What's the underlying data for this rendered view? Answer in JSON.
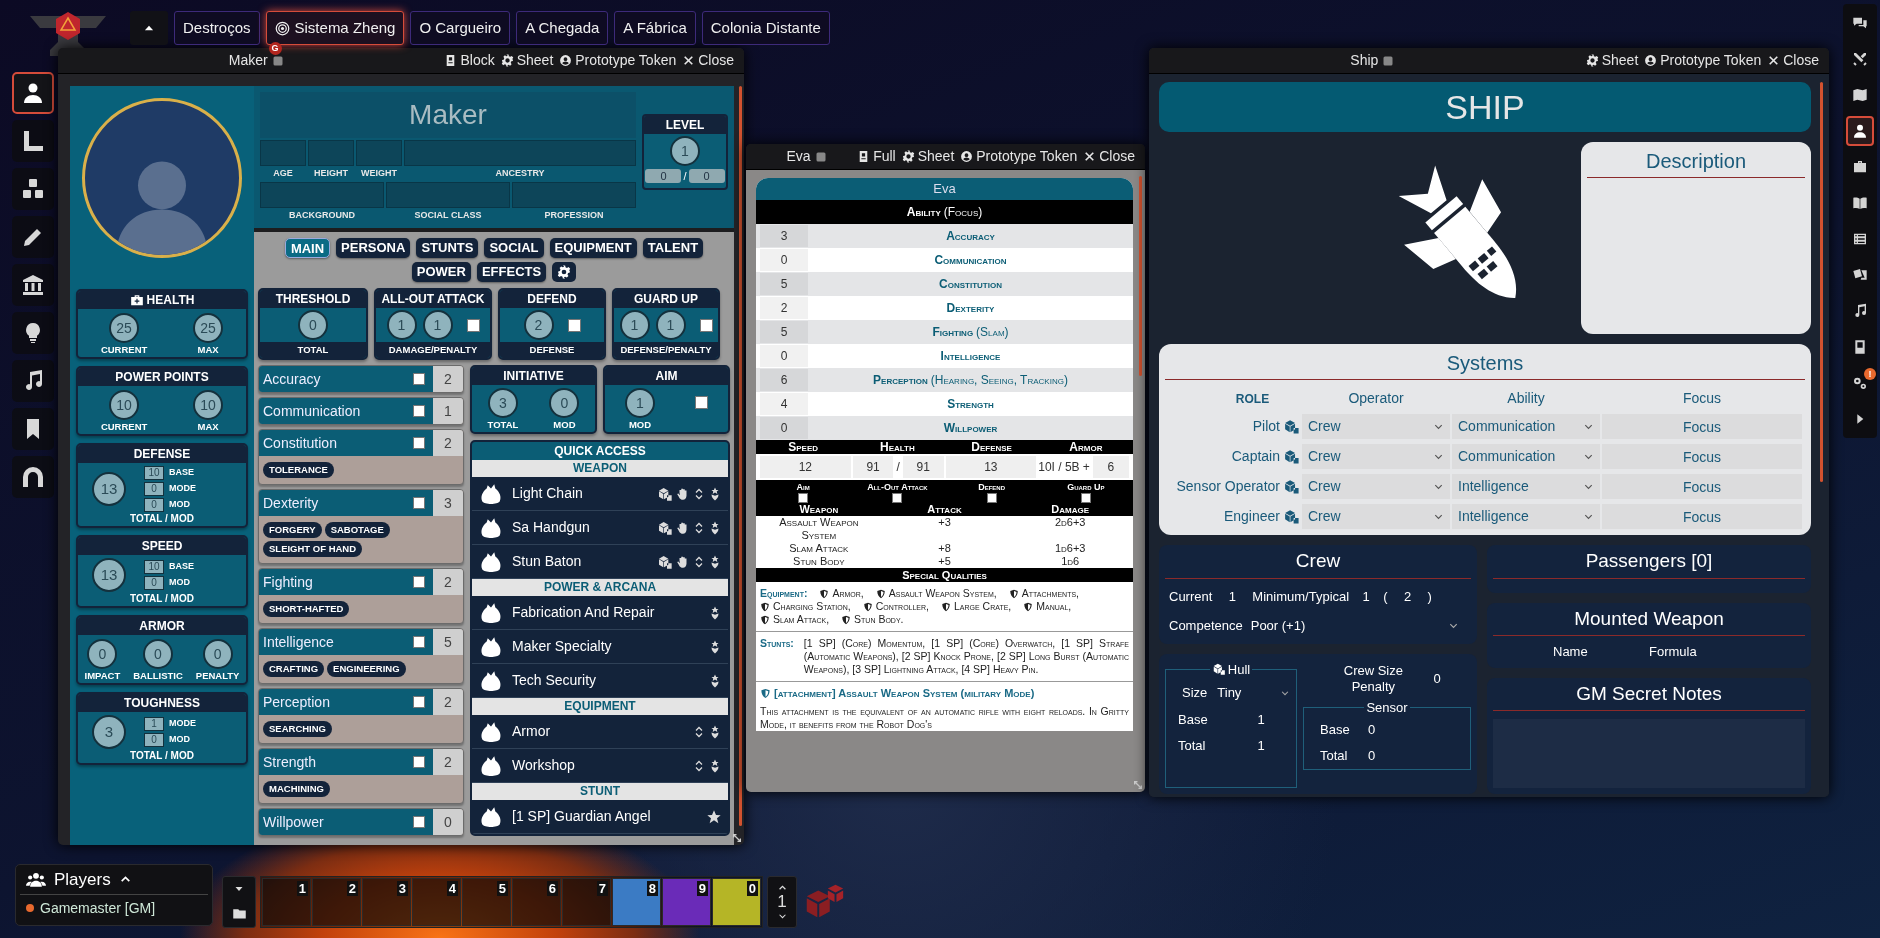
{
  "scene_nav": {
    "scenes": [
      {
        "label": "Destroços",
        "selected": false
      },
      {
        "label": "Sistema Zheng",
        "selected": true,
        "marker": "G"
      },
      {
        "label": "O Cargueiro",
        "selected": false
      },
      {
        "label": "A Chegada",
        "selected": false
      },
      {
        "label": "A Fábrica",
        "selected": false
      },
      {
        "label": "Colonia Distante",
        "selected": false
      }
    ]
  },
  "scene_controls": [
    {
      "kind": "token",
      "selected": true
    },
    {
      "kind": "measure",
      "selected": false
    },
    {
      "kind": "tiles",
      "selected": false
    },
    {
      "kind": "drawing",
      "selected": false
    },
    {
      "kind": "walls",
      "selected": false
    },
    {
      "kind": "lighting",
      "selected": false
    },
    {
      "kind": "sounds",
      "selected": false
    },
    {
      "kind": "notes",
      "selected": false
    },
    {
      "kind": "regions",
      "selected": false
    }
  ],
  "maker_sheet": {
    "window": {
      "title": "Maker",
      "buttons": [
        {
          "kind": "block",
          "label": "Block"
        },
        {
          "kind": "sheet",
          "label": "Sheet"
        },
        {
          "kind": "token",
          "label": "Prototype Token"
        },
        {
          "kind": "close",
          "label": "Close"
        }
      ]
    },
    "name": "Maker",
    "bio_row_1": [
      "AGE",
      "HEIGHT",
      "WEIGHT",
      "ANCESTRY"
    ],
    "bio_row_2": [
      "BACKGROUND",
      "SOCIAL CLASS",
      "PROFESSION"
    ],
    "level": {
      "label": "LEVEL",
      "value": "1",
      "xp_current": "0",
      "separator": "/",
      "xp_next": "0"
    },
    "tabs": [
      {
        "label": "MAIN",
        "selected": true
      },
      {
        "label": "PERSONA",
        "selected": false
      },
      {
        "label": "STUNTS",
        "selected": false
      },
      {
        "label": "SOCIAL",
        "selected": false
      },
      {
        "label": "EQUIPMENT",
        "selected": false
      },
      {
        "label": "TALENT",
        "selected": false
      },
      {
        "label": "POWER",
        "selected": false
      },
      {
        "label": "EFFECTS",
        "selected": false
      }
    ],
    "status_boxes": [
      {
        "kind": "pair",
        "title": "HEALTH",
        "values": [
          {
            "value": "25",
            "label": "CURRENT"
          },
          {
            "value": "25",
            "label": "MAX"
          }
        ]
      },
      {
        "kind": "pair",
        "title": "POWER POINTS",
        "values": [
          {
            "value": "10",
            "label": "CURRENT"
          },
          {
            "value": "10",
            "label": "MAX"
          }
        ]
      },
      {
        "kind": "total_mod",
        "title": "DEFENSE",
        "total": "13",
        "mods": [
          {
            "value": "10",
            "label": "BASE"
          },
          {
            "value": "0",
            "label": "MODE"
          },
          {
            "value": "0",
            "label": "MOD"
          }
        ],
        "footer": "TOTAL / MOD"
      },
      {
        "kind": "total_mod",
        "title": "SPEED",
        "total": "13",
        "mods": [
          {
            "value": "10",
            "label": "BASE"
          },
          {
            "value": "0",
            "label": "MOD"
          }
        ],
        "footer": "TOTAL / MOD"
      },
      {
        "kind": "triple",
        "title": "ARMOR",
        "values": [
          {
            "value": "0",
            "label": "IMPACT"
          },
          {
            "value": "0",
            "label": "BALLISTIC"
          },
          {
            "value": "0",
            "label": "PENALTY"
          }
        ]
      },
      {
        "kind": "total_mod",
        "title": "TOUGHNESS",
        "total": "3",
        "mods": [
          {
            "value": "1",
            "label": "MODE"
          },
          {
            "value": "0",
            "label": "MOD"
          }
        ],
        "footer": "TOTAL / MOD"
      }
    ],
    "combat": [
      {
        "title": "THRESHOLD",
        "values": [
          "0"
        ],
        "footer": "TOTAL"
      },
      {
        "title": "ALL-OUT ATTACK",
        "values": [
          "1",
          "1"
        ],
        "checked": false,
        "footer": "DAMAGE/PENALTY"
      },
      {
        "title": "DEFEND",
        "values": [
          "2"
        ],
        "checked": false,
        "footer": "DEFENSE"
      },
      {
        "title": "GUARD UP",
        "values": [
          "1",
          "1"
        ],
        "checked": false,
        "footer": "DEFENSE/PENALTY"
      }
    ],
    "abilities": [
      {
        "name": "Accuracy",
        "checked": false,
        "value": "2"
      },
      {
        "name": "Communication",
        "checked": false,
        "value": "1"
      },
      {
        "name": "Constitution",
        "checked": false,
        "value": "2",
        "focuses": [
          "TOLERANCE"
        ]
      },
      {
        "name": "Dexterity",
        "checked": false,
        "value": "3",
        "focuses": [
          "FORGERY",
          "SABOTAGE",
          "SLEIGHT OF HAND"
        ]
      },
      {
        "name": "Fighting",
        "checked": false,
        "value": "2",
        "focuses": [
          "SHORT-HAFTED"
        ]
      },
      {
        "name": "Intelligence",
        "checked": false,
        "value": "5",
        "focuses": [
          "CRAFTING",
          "ENGINEERING"
        ]
      },
      {
        "name": "Perception",
        "checked": false,
        "value": "2",
        "focuses": [
          "SEARCHING"
        ]
      },
      {
        "name": "Strength",
        "checked": false,
        "value": "2",
        "focuses": [
          "MACHINING"
        ]
      },
      {
        "name": "Willpower",
        "checked": false,
        "value": "0"
      }
    ],
    "initiative": {
      "title": "INITIATIVE",
      "values": [
        {
          "value": "3",
          "label": "TOTAL"
        },
        {
          "value": "0",
          "label": "MOD"
        }
      ]
    },
    "aim": {
      "title": "AIM",
      "value": "1",
      "label": "MOD",
      "checked": false
    },
    "quick_access": {
      "title": "QUICK ACCESS",
      "sections": [
        {
          "title": "WEAPON",
          "items": [
            {
              "name": "Light Chain",
              "kind": "weapon"
            },
            {
              "name": "Sa Handgun",
              "kind": "weapon"
            },
            {
              "name": "Stun Baton",
              "kind": "weapon"
            }
          ]
        },
        {
          "title": "POWER & ARCANA",
          "items": [
            {
              "name": "Fabrication And Repair",
              "kind": "power"
            },
            {
              "name": "Maker Specialty",
              "kind": "power"
            },
            {
              "name": "Tech Security",
              "kind": "power"
            }
          ]
        },
        {
          "title": "EQUIPMENT",
          "items": [
            {
              "name": "Armor",
              "kind": "equipment"
            },
            {
              "name": "Workshop",
              "kind": "equipment"
            }
          ]
        },
        {
          "title": "STUNT",
          "items": [
            {
              "name": "[1 SP] Guardian Angel",
              "kind": "stunt"
            }
          ]
        }
      ]
    }
  },
  "eva_sheet": {
    "window": {
      "title": "Eva",
      "buttons": [
        {
          "kind": "full",
          "label": "Full"
        },
        {
          "kind": "sheet",
          "label": "Sheet"
        },
        {
          "kind": "token",
          "label": "Prototype Token"
        },
        {
          "kind": "close",
          "label": "Close"
        }
      ]
    },
    "name": "Eva",
    "ability_header": {
      "title": "Ability",
      "focus": "(Focus)"
    },
    "abilities": [
      {
        "value": "3",
        "name": "Accuracy"
      },
      {
        "value": "0",
        "name": "Communication"
      },
      {
        "value": "5",
        "name": "Constitution"
      },
      {
        "value": "2",
        "name": "Dexterity"
      },
      {
        "value": "5",
        "name": "Fighting",
        "focus": "(Slam)"
      },
      {
        "value": "0",
        "name": "Intelligence"
      },
      {
        "value": "6",
        "name": "Perception",
        "focus": "(Hearing, Seeing, Tracking)"
      },
      {
        "value": "4",
        "name": "Strength"
      },
      {
        "value": "0",
        "name": "Willpower"
      }
    ],
    "stats": {
      "labels": [
        "Speed",
        "Health",
        "Defense",
        "Armor"
      ],
      "speed": "12",
      "health": "91",
      "health_separator": "/",
      "health_max": "91",
      "defense": "13",
      "armor": "10I / 5B",
      "armor_plus": "+",
      "armor_bonus": "6"
    },
    "toggles": [
      {
        "label": "Aim",
        "checked": false
      },
      {
        "label": "All-Out Attack",
        "checked": false
      },
      {
        "label": "Defend",
        "checked": false
      },
      {
        "label": "Guard Up",
        "checked": false
      }
    ],
    "weapons": {
      "columns": [
        "Weapon",
        "Attack",
        "Damage"
      ],
      "rows": [
        [
          "Assault Weapon System",
          "+3",
          "2d6+3"
        ],
        [
          "Slam Attack",
          "+8",
          "1d6+3"
        ],
        [
          "Stun Body",
          "+5",
          "1d6"
        ]
      ]
    },
    "special_qualities": "Special Qualities",
    "equipment": {
      "label": "Equipment:",
      "items": [
        "Armor,",
        "Assault Weapon System,",
        "Attachments,",
        "Charging Station,",
        "Controller,",
        "Large Crate,",
        "Manual,",
        "Slam Attack,",
        "Stun Body."
      ]
    },
    "stunts": {
      "label": "Stunts:",
      "text": "[1 SP] (Core) Momentum, [1 SP] (Core) Overwatch, [1 SP] Strafe (Automatic Weapons), [2 SP] Knock Prone, [2 SP] Long Burst (Automatic Weapons), [3 SP] Lightning Attack, [4 SP] Heavy Pin."
    },
    "attachment": {
      "title": "[attachment] Assault Weapon System (military Mode)",
      "text": "This attachment is the equivalent of an automatic rifle with eight reloads. In Gritty Mode, it benefits from the Robot Dog's"
    }
  },
  "ship_sheet": {
    "window": {
      "title": "Ship",
      "buttons": [
        {
          "kind": "sheet",
          "label": "Sheet"
        },
        {
          "kind": "token",
          "label": "Prototype Token"
        },
        {
          "kind": "close",
          "label": "Close"
        }
      ]
    },
    "name": "SHIP",
    "description": {
      "title": "Description"
    },
    "systems": {
      "title": "Systems",
      "columns": [
        "ROLE",
        "Operator",
        "Ability",
        "Focus"
      ],
      "rows": [
        {
          "role": "Pilot",
          "operator": "Crew",
          "ability": "Communication",
          "placeholder": "Focus"
        },
        {
          "role": "Captain",
          "operator": "Crew",
          "ability": "Communication",
          "placeholder": "Focus"
        },
        {
          "role": "Sensor Operator",
          "operator": "Crew",
          "ability": "Intelligence",
          "placeholder": "Focus"
        },
        {
          "role": "Engineer",
          "operator": "Crew",
          "ability": "Intelligence",
          "placeholder": "Focus"
        }
      ]
    },
    "crew": {
      "title": "Crew",
      "current_label": "Current",
      "current": "1",
      "minimum_label": "Minimum/Typical",
      "minimum": "1",
      "open": "(",
      "typical": "2",
      "close": ")",
      "competence_label": "Competence",
      "competence": "Poor (+1)"
    },
    "passengers": {
      "title": "Passengers [0]"
    },
    "mounted_weapon": {
      "title": "Mounted Weapon",
      "columns": [
        "Name",
        "Formula"
      ]
    },
    "hull": {
      "title": "Hull",
      "size_label": "Size",
      "size": "Tiny",
      "base_label": "Base",
      "base": "1",
      "total_label": "Total",
      "total": "1"
    },
    "crew_size_penalty": {
      "label": "Crew Size Penalty",
      "value": "0"
    },
    "sensor": {
      "title": "Sensor",
      "base_label": "Base",
      "base": "0",
      "total_label": "Total",
      "total": "0"
    },
    "gm_notes": {
      "title": "GM Secret Notes"
    }
  },
  "sidebar_tabs": [
    {
      "kind": "chat",
      "selected": false
    },
    {
      "kind": "combat",
      "selected": false
    },
    {
      "kind": "scenes",
      "selected": false
    },
    {
      "kind": "actors",
      "selected": true
    },
    {
      "kind": "items",
      "selected": false
    },
    {
      "kind": "journal",
      "selected": false
    },
    {
      "kind": "tables",
      "selected": false
    },
    {
      "kind": "cards",
      "selected": false
    },
    {
      "kind": "playlists",
      "selected": false
    },
    {
      "kind": "compendium",
      "selected": false
    },
    {
      "kind": "settings",
      "selected": false,
      "badge": "!"
    },
    {
      "kind": "collapse",
      "selected": false
    }
  ],
  "players": {
    "title": "Players",
    "users": [
      {
        "name": "Gamemaster [GM]",
        "color": "#e8692e"
      }
    ]
  },
  "hotbar": {
    "slots": [
      {
        "number": "1",
        "kind": "empty"
      },
      {
        "number": "2",
        "kind": "empty"
      },
      {
        "number": "3",
        "kind": "empty"
      },
      {
        "number": "4",
        "kind": "empty"
      },
      {
        "number": "5",
        "kind": "empty"
      },
      {
        "number": "6",
        "kind": "empty"
      },
      {
        "number": "7",
        "kind": "empty"
      },
      {
        "number": "8",
        "kind": "macro",
        "color": "#3b7bc4"
      },
      {
        "number": "9",
        "kind": "macro",
        "color": "#6a2bb8"
      },
      {
        "number": "0",
        "kind": "macro",
        "color": "#b5b526"
      }
    ],
    "page": "1"
  }
}
